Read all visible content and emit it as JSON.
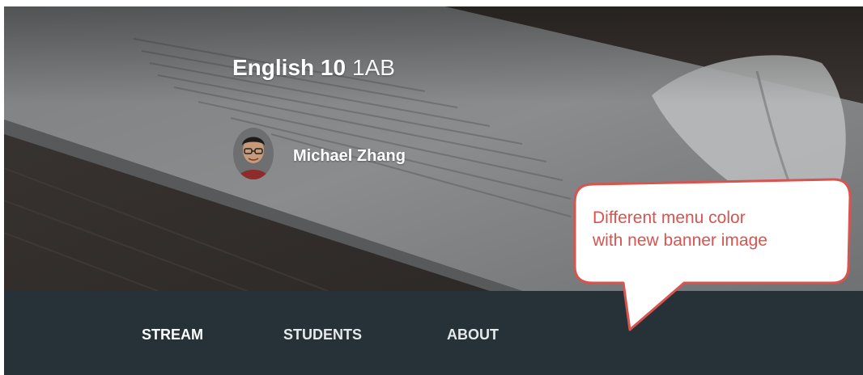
{
  "banner": {
    "course": "English 10",
    "section": "1AB",
    "teacher_name": "Michael Zhang"
  },
  "menu": {
    "tabs": [
      {
        "label": "STREAM"
      },
      {
        "label": "STUDENTS"
      },
      {
        "label": "ABOUT"
      }
    ],
    "background_color": "#263238"
  },
  "annotation": {
    "line1": "Different menu color",
    "line2": "with new banner image",
    "text_color": "#d9534f",
    "border_color": "#d9534f"
  }
}
